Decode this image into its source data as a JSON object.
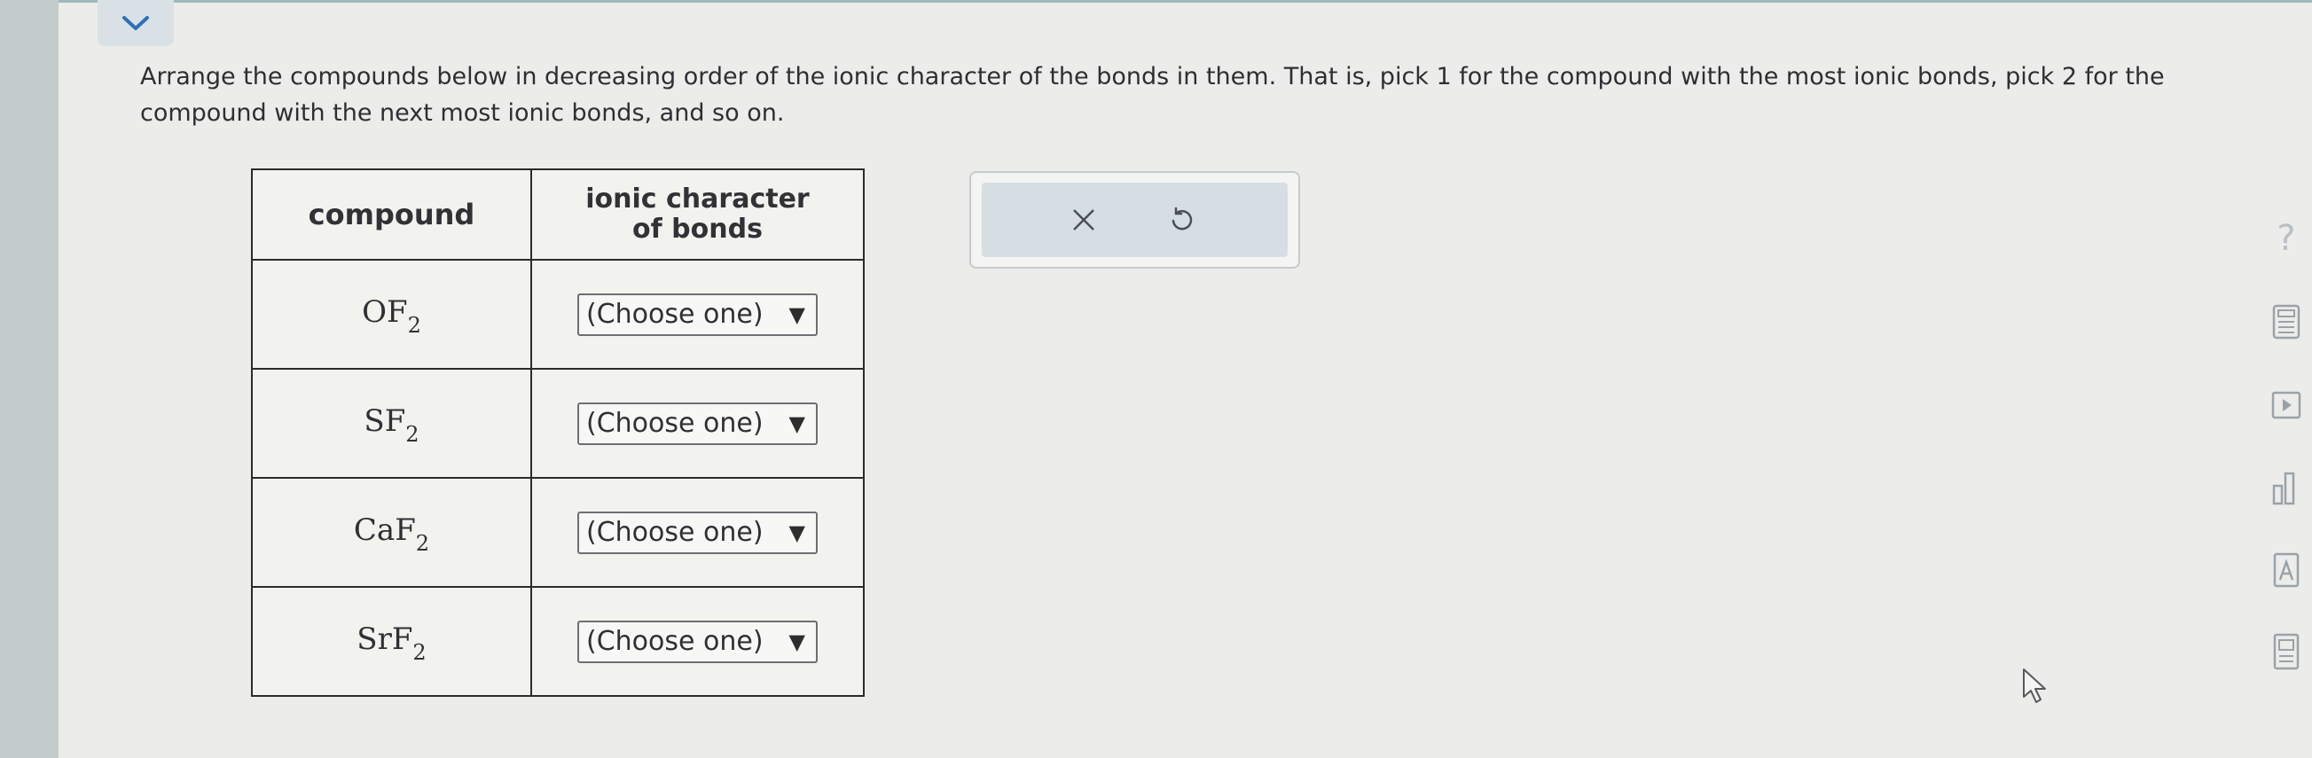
{
  "prompt_text": "Arrange the compounds below in decreasing order of the ionic character of the bonds in them. That is, pick 1 for the compound with the most ionic bonds, pick 2 for the compound with the next most ionic bonds, and so on.",
  "table": {
    "headers": {
      "compound": "compound",
      "ionic_char_line1": "ionic character",
      "ionic_char_line2": "of bonds"
    },
    "rows": [
      {
        "base": "OF",
        "sub": "2",
        "choice": "(Choose one)"
      },
      {
        "base": "SF",
        "sub": "2",
        "choice": "(Choose one)"
      },
      {
        "base": "CaF",
        "sub": "2",
        "choice": "(Choose one)"
      },
      {
        "base": "SrF",
        "sub": "2",
        "choice": "(Choose one)"
      }
    ]
  },
  "select_arrow": "▼",
  "help_glyph": "?",
  "icons": {
    "collapse": "chevron-down-icon",
    "clear": "x-icon",
    "undo": "undo-icon",
    "help": "question-icon",
    "calculator": "calculator-icon",
    "video": "play-icon",
    "data": "bar-chart-icon",
    "reference": "reference-icon",
    "periodic_table": "periodic-table-icon",
    "cursor": "pointer-cursor-icon"
  },
  "colors": {
    "page_bg": "#ececea",
    "chevron": "#2f6fb5",
    "table_border": "#2b2b2b",
    "action_bg": "#d6dee3"
  }
}
